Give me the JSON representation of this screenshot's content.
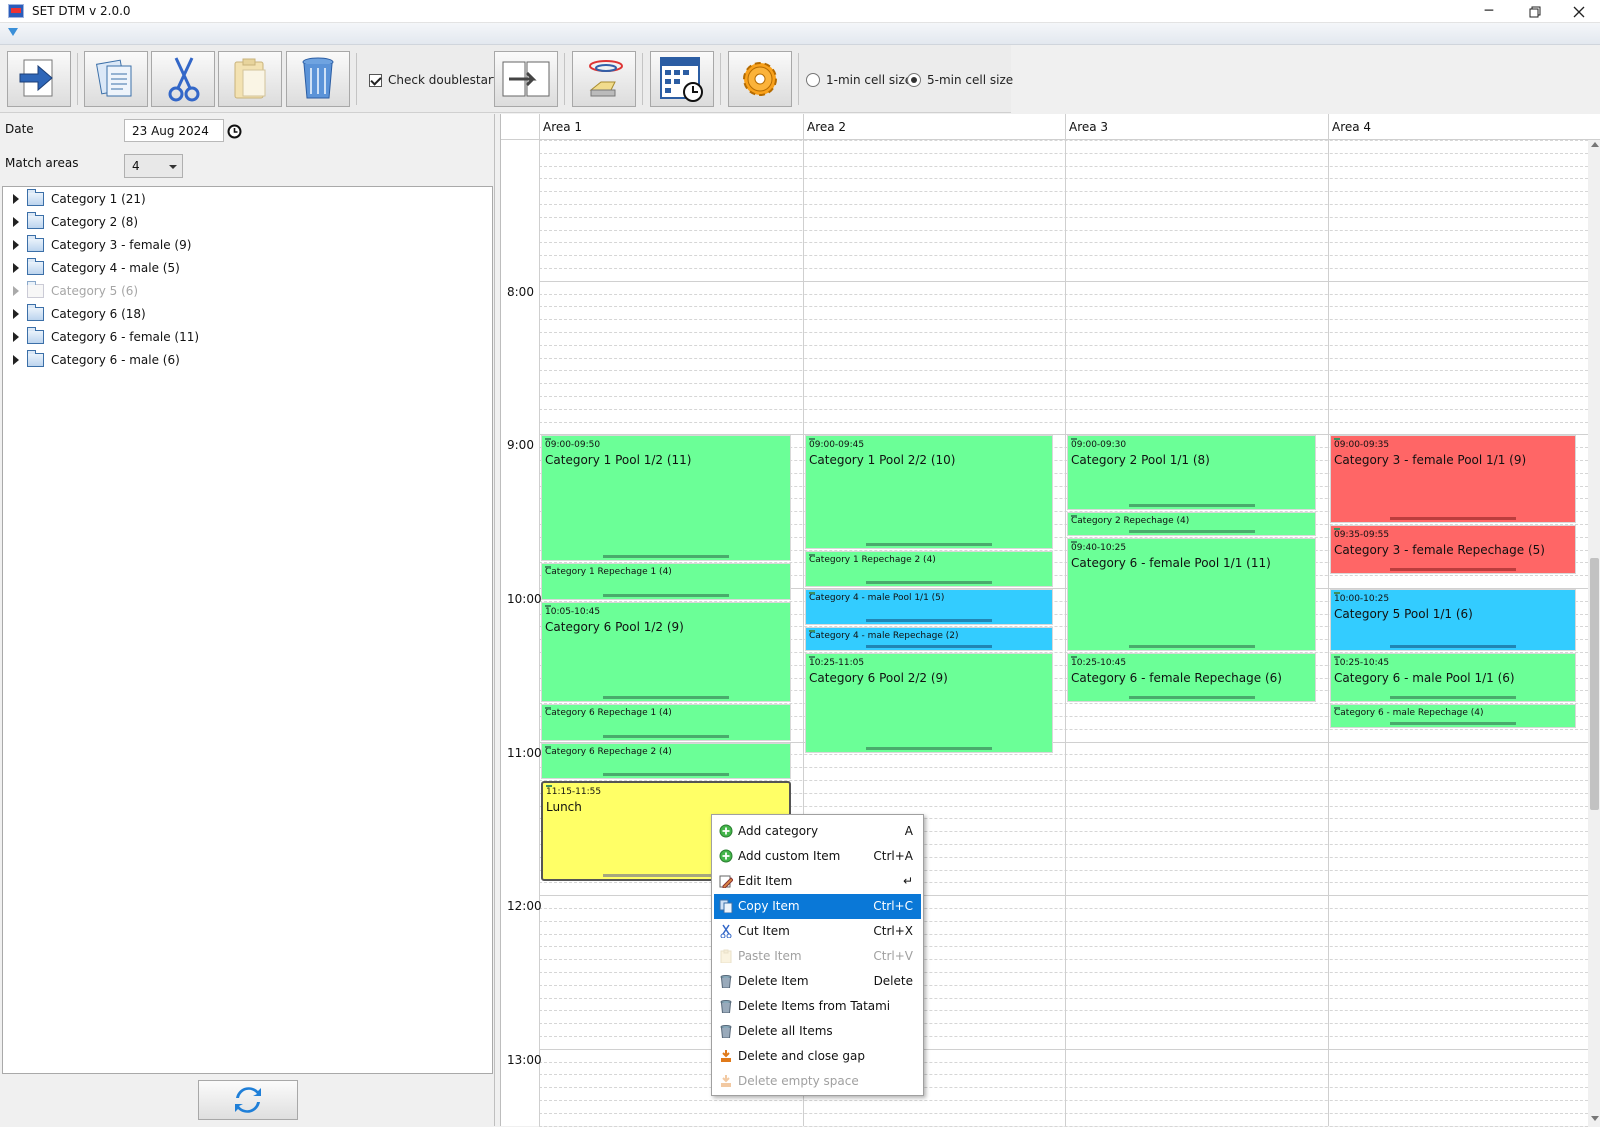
{
  "window": {
    "title": "SET DTM v 2.0.0"
  },
  "toolbar": {
    "check_doublestarts_label": "Check doublestarts",
    "check_doublestarts_checked": true,
    "cell_size_1min_label": "1-min cell size",
    "cell_size_5min_label": "5-min cell size",
    "selected_cell_size": "5-min"
  },
  "left": {
    "date_label": "Date",
    "date_value": "23 Aug 2024",
    "match_areas_label": "Match areas",
    "match_areas_value": "4",
    "categories": [
      {
        "label": "Category 1 (21)",
        "disabled": false
      },
      {
        "label": "Category 2 (8)",
        "disabled": false
      },
      {
        "label": "Category 3 - female (9)",
        "disabled": false
      },
      {
        "label": "Category 4 - male (5)",
        "disabled": false
      },
      {
        "label": "Category 5 (6)",
        "disabled": true
      },
      {
        "label": "Category 6 (18)",
        "disabled": false
      },
      {
        "label": "Category 6 - female (11)",
        "disabled": false
      },
      {
        "label": "Category 6 - male (6)",
        "disabled": false
      }
    ]
  },
  "schedule": {
    "areas": [
      "Area 1",
      "Area 2",
      "Area 3",
      "Area 4"
    ],
    "hours": [
      "8:00",
      "9:00",
      "10:00",
      "11:00",
      "12:00",
      "13:00"
    ],
    "events": [
      {
        "area": 0,
        "color": "green",
        "start": "09:00",
        "end": "09:50",
        "time": "09:00-09:50",
        "name": "Category 1 Pool 1/2 (11)"
      },
      {
        "area": 0,
        "color": "green",
        "start": "09:50",
        "end": "10:05",
        "time": "",
        "name": "Category 1 Repechage 1 (4)"
      },
      {
        "area": 0,
        "color": "green",
        "start": "10:05",
        "end": "10:45",
        "time": "10:05-10:45",
        "name": "Category 6 Pool 1/2 (9)"
      },
      {
        "area": 0,
        "color": "green",
        "start": "10:45",
        "end": "11:00",
        "time": "",
        "name": "Category 6 Repechage 1 (4)"
      },
      {
        "area": 0,
        "color": "green",
        "start": "11:00",
        "end": "11:15",
        "time": "",
        "name": "Category 6 Repechage 2 (4)"
      },
      {
        "area": 0,
        "color": "yellow",
        "start": "11:15",
        "end": "11:55",
        "time": "11:15-11:55",
        "name": "Lunch"
      },
      {
        "area": 1,
        "color": "green",
        "start": "09:00",
        "end": "09:45",
        "time": "09:00-09:45",
        "name": "Category 1 Pool 2/2 (10)"
      },
      {
        "area": 1,
        "color": "green",
        "start": "09:45",
        "end": "10:00",
        "time": "",
        "name": "Category 1 Repechage 2 (4)"
      },
      {
        "area": 1,
        "color": "blue",
        "start": "10:00",
        "end": "10:15",
        "time": "",
        "name": "Category 4 - male Pool 1/1 (5)"
      },
      {
        "area": 1,
        "color": "blue",
        "start": "10:15",
        "end": "10:25",
        "time": "",
        "name": "Category 4 - male Repechage (2)"
      },
      {
        "area": 1,
        "color": "green",
        "start": "10:25",
        "end": "11:05",
        "time": "10:25-11:05",
        "name": "Category 6 Pool 2/2 (9)"
      },
      {
        "area": 2,
        "color": "green",
        "start": "09:00",
        "end": "09:30",
        "time": "09:00-09:30",
        "name": "Category 2 Pool 1/1 (8)"
      },
      {
        "area": 2,
        "color": "green",
        "start": "09:30",
        "end": "09:40",
        "time": "",
        "name": "Category 2 Repechage (4)"
      },
      {
        "area": 2,
        "color": "green",
        "start": "09:40",
        "end": "10:25",
        "time": "09:40-10:25",
        "name": "Category 6 - female Pool 1/1 (11)"
      },
      {
        "area": 2,
        "color": "green",
        "start": "10:25",
        "end": "10:45",
        "time": "10:25-10:45",
        "name": "Category 6 - female Repechage (6)"
      },
      {
        "area": 3,
        "color": "red",
        "start": "09:00",
        "end": "09:35",
        "time": "09:00-09:35",
        "name": "Category 3 - female Pool 1/1 (9)"
      },
      {
        "area": 3,
        "color": "red",
        "start": "09:35",
        "end": "09:55",
        "time": "09:35-09:55",
        "name": "Category 3 - female Repechage (5)"
      },
      {
        "area": 3,
        "color": "blue",
        "start": "10:00",
        "end": "10:25",
        "time": "10:00-10:25",
        "name": "Category 5 Pool 1/1 (6)"
      },
      {
        "area": 3,
        "color": "green",
        "start": "10:25",
        "end": "10:45",
        "time": "10:25-10:45",
        "name": "Category 6 - male Pool 1/1 (6)"
      },
      {
        "area": 3,
        "color": "green",
        "start": "10:45",
        "end": "10:55",
        "time": "",
        "name": "Category 6 - male Repechage (4)"
      }
    ]
  },
  "context_menu": {
    "items": [
      {
        "label": "Add category",
        "shortcut": "A",
        "icon": "add-icon",
        "disabled": false,
        "highlighted": false
      },
      {
        "label": "Add custom Item",
        "shortcut": "Ctrl+A",
        "icon": "add-icon",
        "disabled": false,
        "highlighted": false
      },
      {
        "label": "Edit Item",
        "shortcut": "↵",
        "icon": "edit-icon",
        "disabled": false,
        "highlighted": false
      },
      {
        "label": "Copy Item",
        "shortcut": "Ctrl+C",
        "icon": "copy-icon",
        "disabled": false,
        "highlighted": true
      },
      {
        "label": "Cut Item",
        "shortcut": "Ctrl+X",
        "icon": "scissors-icon",
        "disabled": false,
        "highlighted": false
      },
      {
        "label": "Paste Item",
        "shortcut": "Ctrl+V",
        "icon": "paste-icon",
        "disabled": true,
        "highlighted": false
      },
      {
        "label": "Delete Item",
        "shortcut": "Delete",
        "icon": "trash-icon",
        "disabled": false,
        "highlighted": false
      },
      {
        "label": "Delete Items from Tatami",
        "shortcut": "",
        "icon": "trash-icon",
        "disabled": false,
        "highlighted": false
      },
      {
        "label": "Delete all Items",
        "shortcut": "",
        "icon": "trash-icon",
        "disabled": false,
        "highlighted": false
      },
      {
        "label": "Delete and close gap",
        "shortcut": "",
        "icon": "close-gap-icon",
        "disabled": false,
        "highlighted": false
      },
      {
        "label": "Delete empty space",
        "shortcut": "",
        "icon": "close-gap-icon",
        "disabled": true,
        "highlighted": false
      }
    ]
  },
  "colors": {
    "green": "#6bff97",
    "red": "#ff6666",
    "blue": "#33ccff",
    "yellow": "#ffff66",
    "highlight": "#0a78d7"
  }
}
